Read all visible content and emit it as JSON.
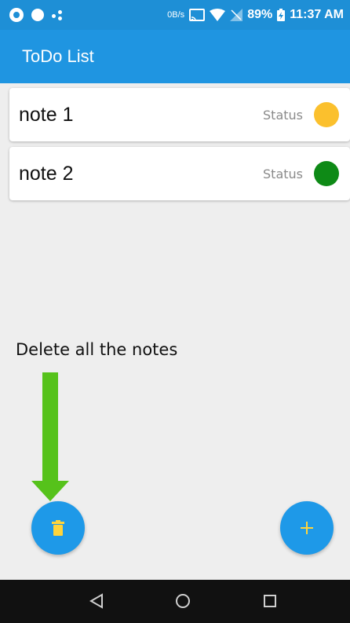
{
  "status_bar": {
    "net_speed": "0B/s",
    "battery": "89%",
    "time": "11:37 AM",
    "icons": [
      "aperture-icon",
      "circle-icon",
      "assistant-dots-icon",
      "screen-cast-icon",
      "wifi-icon",
      "signal-icon",
      "battery-icon"
    ]
  },
  "app_bar": {
    "title": "ToDo List"
  },
  "notes": [
    {
      "title": "note 1",
      "status_label": "Status",
      "status_color": "#fbc02d"
    },
    {
      "title": "note 2",
      "status_label": "Status",
      "status_color": "#0e8a16"
    }
  ],
  "annotation": {
    "text": "Delete all the notes",
    "arrow_color": "#56c21b"
  },
  "fab_delete": {
    "icon": "trash-icon",
    "icon_color": "#ffd43b",
    "color": "#1e99e8"
  },
  "fab_add": {
    "icon": "plus-icon",
    "icon_color": "#ffd43b",
    "color": "#1e99e8"
  },
  "nav_bar": {
    "icons": [
      "back-triangle-icon",
      "home-circle-icon",
      "recents-square-icon"
    ]
  }
}
